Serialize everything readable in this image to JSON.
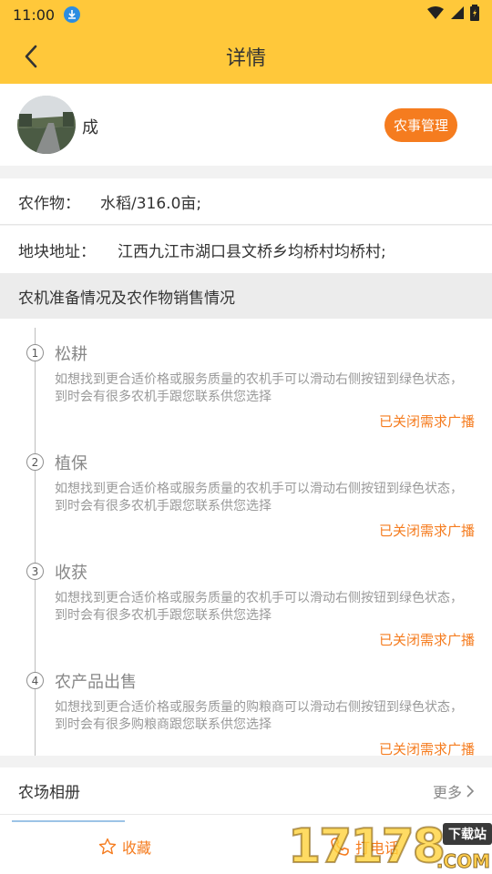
{
  "status_bar": {
    "time": "11:00"
  },
  "header": {
    "title": "详情"
  },
  "profile": {
    "name": "成",
    "farm_button": "农事管理"
  },
  "info": {
    "crop_label": "农作物：",
    "crop_value": "水稻/316.0亩;",
    "address_label": "地块地址：",
    "address_value": "江西九江市湖口县文桥乡均桥村均桥村;"
  },
  "section": {
    "title": "农机准备情况及农作物销售情况"
  },
  "steps": [
    {
      "num": "1",
      "title": "松耕",
      "desc": "如想找到更合适价格或服务质量的农机手可以滑动右侧按钮到绿色状态，到时会有很多农机手跟您联系供您选择",
      "status": "已关闭需求广播"
    },
    {
      "num": "2",
      "title": "植保",
      "desc": "如想找到更合适价格或服务质量的农机手可以滑动右侧按钮到绿色状态，到时会有很多农机手跟您联系供您选择",
      "status": "已关闭需求广播"
    },
    {
      "num": "3",
      "title": "收获",
      "desc": "如想找到更合适价格或服务质量的农机手可以滑动右侧按钮到绿色状态，到时会有很多农机手跟您联系供您选择",
      "status": "已关闭需求广播"
    },
    {
      "num": "4",
      "title": "农产品出售",
      "desc": "如想找到更合适价格或服务质量的购粮商可以滑动右侧按钮到绿色状态，到时会有很多购粮商跟您联系供您选择",
      "status": "已关闭需求广播"
    }
  ],
  "album": {
    "title": "农场相册",
    "more": "更多"
  },
  "bottom_bar": {
    "favorite": "收藏",
    "call": "打电话"
  },
  "watermark": {
    "digits": "17178",
    "tag": "下载站",
    "domain": ".COM"
  },
  "colors": {
    "header_bg": "#ffc83a",
    "accent": "#f57c1f"
  }
}
